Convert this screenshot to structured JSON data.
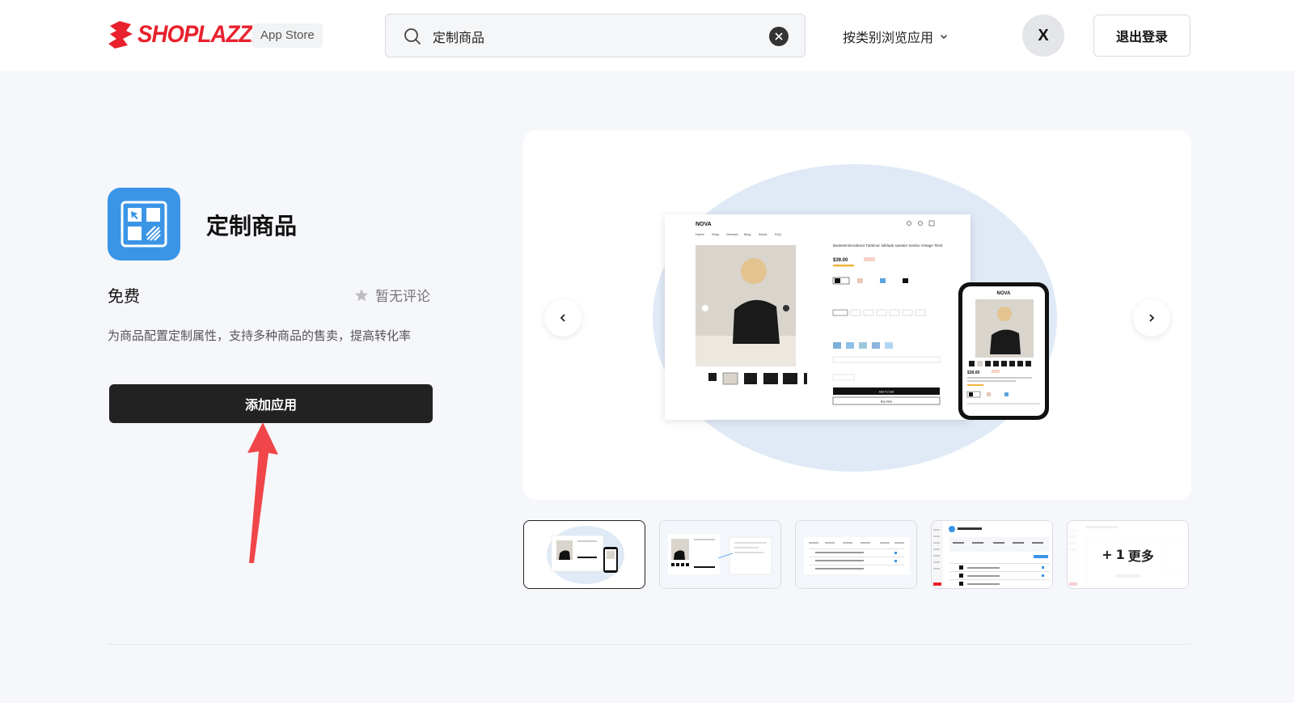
{
  "header": {
    "brand": "SHOPLAZZA",
    "badge": "App Store",
    "search_value": "定制商品",
    "browse_label": "按类别浏览应用",
    "avatar_letter": "X",
    "logout_label": "退出登录"
  },
  "app": {
    "title": "定制商品",
    "price": "免费",
    "rating": "暂无评论",
    "description": "为商品配置定制属性，支持多种商品的售卖，提高转化率",
    "add_label": "添加应用"
  },
  "gallery": {
    "more_prefix": "+",
    "more_count": "1",
    "more_label": "更多",
    "mock": {
      "brand": "NOVA",
      "nav": [
        "Home",
        "Shop",
        "Dresses",
        "Blog",
        "About",
        "FAQ"
      ],
      "product_title": "Basketembroidered Tuttlenec lolblade sweater Similar Vintage Tshirt",
      "price": "$39.00",
      "add_to_cart": "Add To Cart",
      "buy_now": "Buy Now"
    }
  },
  "colors": {
    "brand_red": "#e8212d",
    "app_icon_blue": "#3a95e6",
    "button_dark": "#222222",
    "arrow_red": "#f0464a"
  }
}
